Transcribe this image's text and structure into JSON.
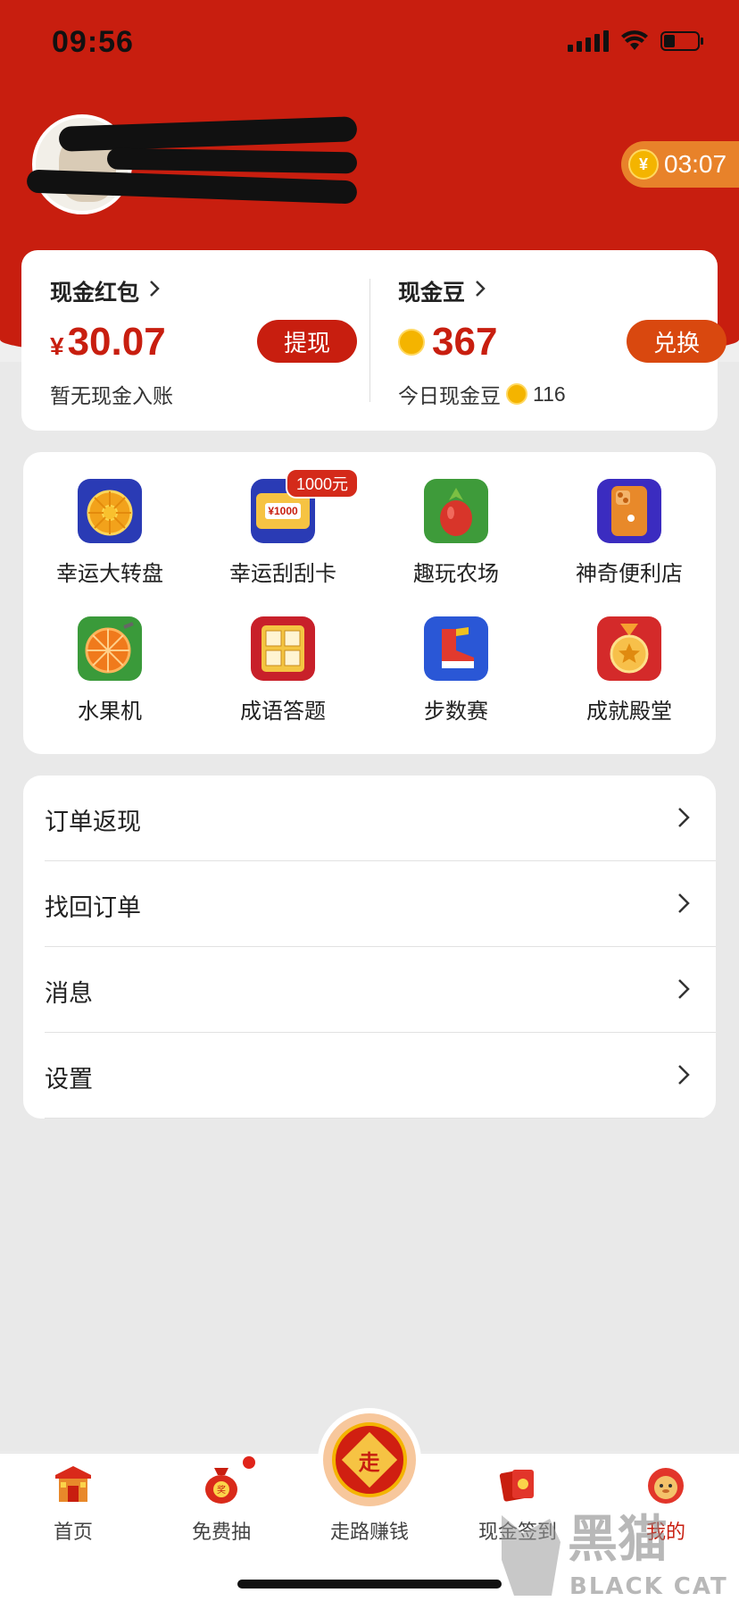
{
  "status_bar": {
    "time": "09:56"
  },
  "header": {
    "timer": "03:07",
    "timer_coin": "¥"
  },
  "balance": {
    "cash": {
      "title": "现金红包",
      "currency": "¥",
      "amount": "30.07",
      "button": "提现",
      "subtitle": "暂无现金入账"
    },
    "beans": {
      "title": "现金豆",
      "amount": "367",
      "button": "兑换",
      "subtitle_prefix": "今日现金豆",
      "today": "116"
    }
  },
  "grid": {
    "badge": "1000元",
    "items": [
      {
        "label": "幸运大转盘",
        "icon": "wheel-icon"
      },
      {
        "label": "幸运刮刮卡",
        "icon": "scratch-card-icon"
      },
      {
        "label": "趣玩农场",
        "icon": "farm-icon"
      },
      {
        "label": "神奇便利店",
        "icon": "store-icon"
      },
      {
        "label": "水果机",
        "icon": "fruit-machine-icon"
      },
      {
        "label": "成语答题",
        "icon": "idiom-quiz-icon"
      },
      {
        "label": "步数赛",
        "icon": "step-race-icon"
      },
      {
        "label": "成就殿堂",
        "icon": "achievement-icon"
      }
    ],
    "scratch_card_text": "¥1000"
  },
  "menu": {
    "items": [
      {
        "label": "订单返现"
      },
      {
        "label": "找回订单"
      },
      {
        "label": "消息"
      },
      {
        "label": "设置"
      }
    ]
  },
  "tabbar": {
    "items": [
      {
        "label": "首页",
        "icon": "home-icon"
      },
      {
        "label": "免费抽",
        "icon": "lucky-bag-icon"
      },
      {
        "label": "走路赚钱",
        "icon": "walk-icon"
      },
      {
        "label": "现金签到",
        "icon": "red-envelope-icon"
      },
      {
        "label": "我的",
        "icon": "profile-icon"
      }
    ],
    "center_char": "走"
  },
  "watermark": {
    "text_cn": "黑猫",
    "text_en": "BLACK CAT"
  },
  "colors": {
    "brand_red": "#c81e0f",
    "orange": "#d9480f",
    "coin": "#f4b400"
  }
}
